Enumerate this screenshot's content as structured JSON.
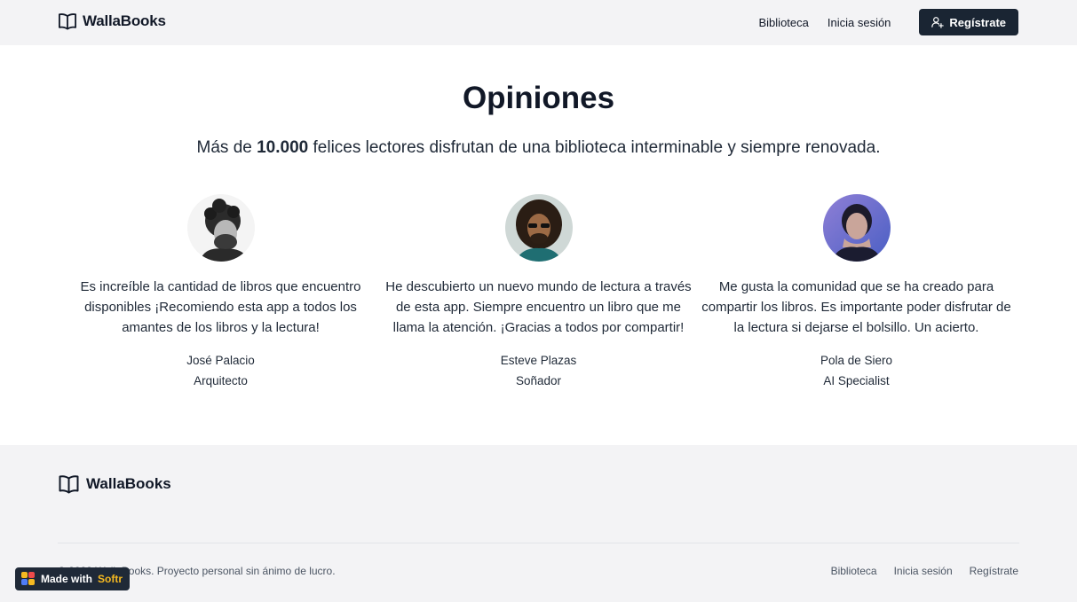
{
  "header": {
    "brand": "WallaBooks",
    "nav": [
      "Biblioteca",
      "Inicia sesión"
    ],
    "signup_label": "Regístrate"
  },
  "main": {
    "title": "Opiniones",
    "subtitle_before": "Más de ",
    "subtitle_bold": "10.000",
    "subtitle_after": " felices lectores disfrutan de una biblioteca interminable y siempre renovada.",
    "testimonials": [
      {
        "quote": "Es increíble la cantidad de libros que encuentro disponibles ¡Recomiendo esta app a todos los amantes de los libros y la lectura!",
        "name": "José Palacio",
        "role": "Arquitecto"
      },
      {
        "quote": "He descubierto un nuevo mundo de lectura a través de esta app. Siempre encuentro un libro que me llama la atención. ¡Gracias a todos por compartir!",
        "name": "Esteve Plazas",
        "role": "Soñador"
      },
      {
        "quote": "Me gusta la comunidad que se ha creado para compartir los libros. Es importante poder disfrutar de la lectura si dejarse el bolsillo. Un acierto.",
        "name": "Pola de Siero",
        "role": "AI Specialist"
      }
    ]
  },
  "footer": {
    "brand": "WallaBooks",
    "copyright": "© 2023 WallaBooks. Proyecto personal sin ánimo de lucro.",
    "nav": [
      "Biblioteca",
      "Inicia sesión",
      "Regístrate"
    ]
  },
  "badge": {
    "text": "Made with",
    "brand": "Softr"
  },
  "colors": {
    "accent_dark": "#1a2533",
    "page_bg": "#f3f3f5",
    "badge_brand": "#f5b921"
  }
}
